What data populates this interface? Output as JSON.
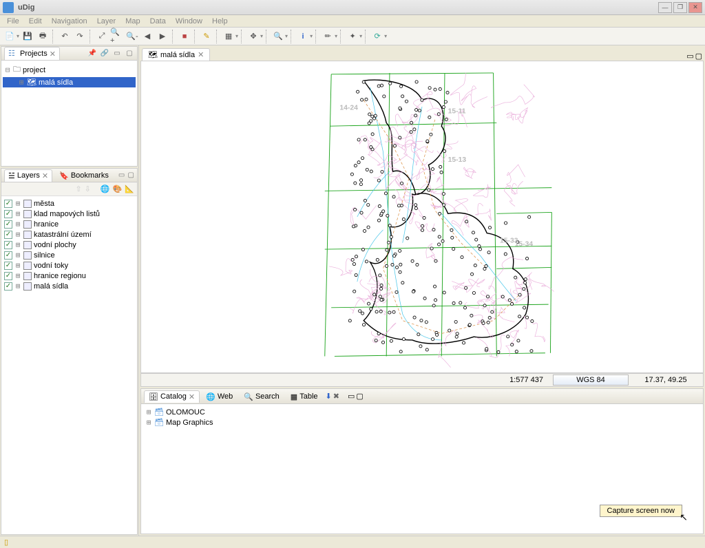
{
  "window": {
    "title": "uDig"
  },
  "menu": {
    "items": [
      "File",
      "Edit",
      "Navigation",
      "Layer",
      "Map",
      "Data",
      "Window",
      "Help"
    ]
  },
  "projects_panel": {
    "title": "Projects",
    "root": "project",
    "child": "malá sídla"
  },
  "layers_panel": {
    "tabs": {
      "layers": "Layers",
      "bookmarks": "Bookmarks"
    },
    "items": [
      {
        "label": "města"
      },
      {
        "label": "klad mapových listů"
      },
      {
        "label": "hranice"
      },
      {
        "label": "katastrální území"
      },
      {
        "label": "vodní plochy"
      },
      {
        "label": "silnice"
      },
      {
        "label": "vodní toky"
      },
      {
        "label": "hranice regionu"
      },
      {
        "label": "malá sídla"
      }
    ]
  },
  "editor": {
    "tab": "malá sídla"
  },
  "map_status": {
    "scale": "1:577 437",
    "crs": "WGS 84",
    "coords": "17.37, 49.25"
  },
  "bottom_panel": {
    "tabs": {
      "catalog": "Catalog",
      "web": "Web",
      "search": "Search",
      "table": "Table"
    },
    "items": [
      {
        "label": "OLOMOUC"
      },
      {
        "label": "Map Graphics"
      }
    ]
  },
  "tooltip": "Capture screen now",
  "grid_labels": [
    "14-24",
    "15-11",
    "15-13",
    "15-33",
    "15-34"
  ]
}
